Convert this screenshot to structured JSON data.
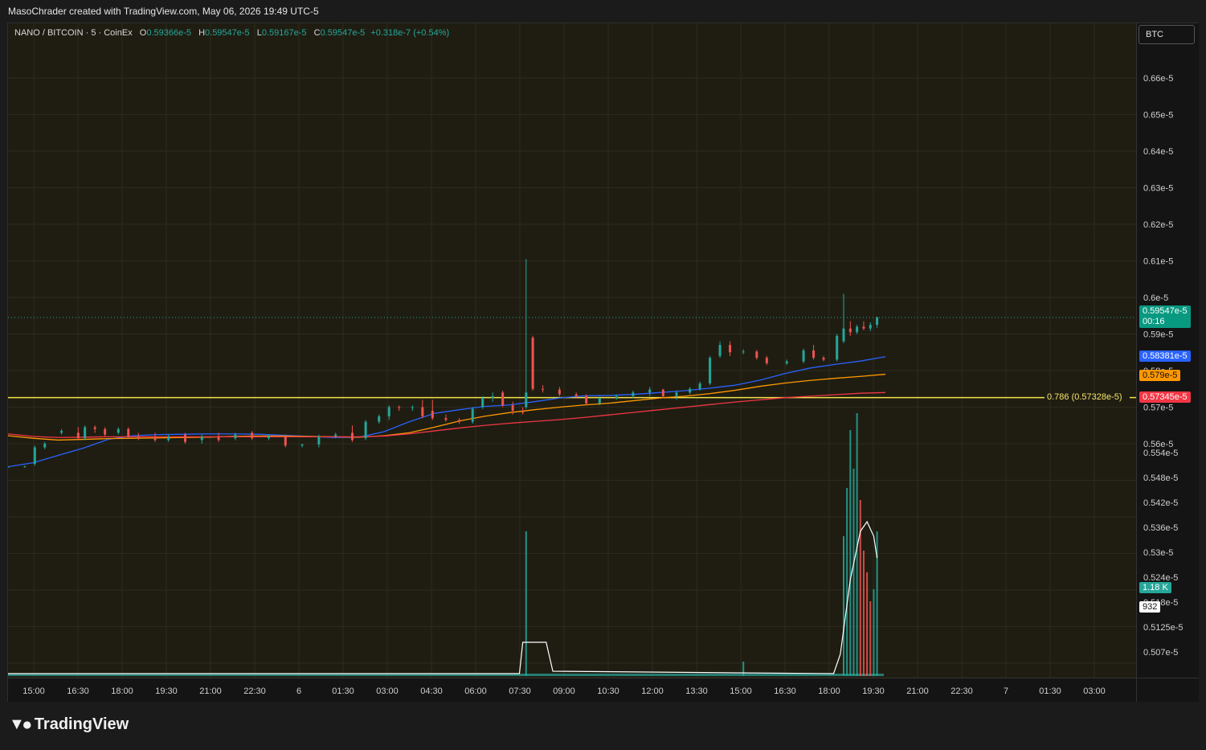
{
  "credit": "MasoChrader created with TradingView.com, May 06, 2026 19:49 UTC-5",
  "legend": {
    "symbol": "NANO / BITCOIN · 5 · CoinEx",
    "o_label": "O",
    "o": "0.59366e-5",
    "h_label": "H",
    "h": "0.59547e-5",
    "l_label": "L",
    "l": "0.59167e-5",
    "c_label": "C",
    "c": "0.59547e-5",
    "change": "+0.318e-7 (+0.54%)"
  },
  "currency": "BTC",
  "brand": "TradingView",
  "colors": {
    "bg": "#1f1d12",
    "up": "#26a69a",
    "down": "#ef5350",
    "ma_blue": "#2962ff",
    "ma_orange": "#ff9800",
    "ma_red": "#f23645",
    "fib": "#f5e34a",
    "volume_ma": "#ffffff"
  },
  "badges": {
    "last_price": "0.59547e-5",
    "countdown": "00:16",
    "ma_blue": "0.58381e-5",
    "ma_orange": "0.579e-5",
    "ma_red": "0.57345e-5",
    "volume": "1.18 K",
    "volume_ma": "932"
  },
  "fib_label": "0.786 (0.57328e-5)",
  "chart_data": {
    "type": "candlestick",
    "symbol": "NANO / BITCOIN",
    "interval": "5",
    "exchange": "CoinEx",
    "x_ticks": [
      "15:00",
      "16:30",
      "18:00",
      "19:30",
      "21:00",
      "22:30",
      "6",
      "01:30",
      "03:00",
      "04:30",
      "06:00",
      "07:30",
      "09:00",
      "10:30",
      "12:00",
      "13:30",
      "15:00",
      "16:30",
      "18:00",
      "19:30",
      "21:00",
      "22:30",
      "7",
      "01:30",
      "03:00"
    ],
    "y_ticks_price": [
      "0.66e-5",
      "0.65e-5",
      "0.64e-5",
      "0.63e-5",
      "0.62e-5",
      "0.61e-5",
      "0.6e-5",
      "0.59e-5",
      "0.58e-5",
      "0.57e-5",
      "0.56e-5"
    ],
    "y_ticks_volume": [
      "0.554e-5",
      "0.548e-5",
      "0.542e-5",
      "0.536e-5",
      "0.53e-5",
      "0.524e-5",
      "0.518e-5",
      "0.5125e-5",
      "0.507e-5"
    ],
    "fib_level": {
      "ratio": 0.786,
      "price": 0.57328
    },
    "moving_averages": [
      {
        "color": "blue",
        "last": 0.58381,
        "points": [
          [
            0,
            0.5537
          ],
          [
            2,
            0.5548
          ],
          [
            4,
            0.5568
          ],
          [
            6,
            0.5588
          ],
          [
            8,
            0.5612
          ],
          [
            10,
            0.5622
          ],
          [
            12,
            0.5625
          ],
          [
            14,
            0.5626
          ],
          [
            16,
            0.5627
          ],
          [
            18,
            0.5627
          ],
          [
            20,
            0.5626
          ],
          [
            22,
            0.5623
          ],
          [
            24,
            0.562
          ],
          [
            26,
            0.5617
          ],
          [
            28,
            0.5618
          ],
          [
            30,
            0.5633
          ],
          [
            32,
            0.566
          ],
          [
            34,
            0.5683
          ],
          [
            36,
            0.5693
          ],
          [
            38,
            0.5702
          ],
          [
            40,
            0.5706
          ],
          [
            42,
            0.5715
          ],
          [
            44,
            0.5725
          ],
          [
            46,
            0.5731
          ],
          [
            48,
            0.5732
          ],
          [
            50,
            0.5735
          ],
          [
            52,
            0.574
          ],
          [
            54,
            0.5745
          ],
          [
            56,
            0.5752
          ],
          [
            58,
            0.576
          ],
          [
            60,
            0.5774
          ],
          [
            62,
            0.5792
          ],
          [
            64,
            0.5807
          ],
          [
            66,
            0.5817
          ],
          [
            68,
            0.5826
          ],
          [
            70,
            0.5838
          ]
        ]
      },
      {
        "color": "orange",
        "last": 0.579,
        "points": [
          [
            0,
            0.5622
          ],
          [
            2,
            0.5615
          ],
          [
            4,
            0.561
          ],
          [
            6,
            0.5612
          ],
          [
            8,
            0.5614
          ],
          [
            10,
            0.5615
          ],
          [
            12,
            0.5616
          ],
          [
            14,
            0.5617
          ],
          [
            16,
            0.5618
          ],
          [
            18,
            0.562
          ],
          [
            20,
            0.5621
          ],
          [
            22,
            0.5621
          ],
          [
            24,
            0.562
          ],
          [
            26,
            0.5619
          ],
          [
            28,
            0.5618
          ],
          [
            30,
            0.5622
          ],
          [
            32,
            0.563
          ],
          [
            34,
            0.5645
          ],
          [
            36,
            0.5662
          ],
          [
            38,
            0.5675
          ],
          [
            40,
            0.5685
          ],
          [
            42,
            0.5693
          ],
          [
            44,
            0.57
          ],
          [
            46,
            0.5706
          ],
          [
            48,
            0.5711
          ],
          [
            50,
            0.5718
          ],
          [
            52,
            0.5725
          ],
          [
            54,
            0.573
          ],
          [
            56,
            0.5737
          ],
          [
            58,
            0.5746
          ],
          [
            60,
            0.5757
          ],
          [
            62,
            0.5766
          ],
          [
            64,
            0.5773
          ],
          [
            66,
            0.5779
          ],
          [
            68,
            0.5784
          ],
          [
            70,
            0.579
          ]
        ]
      },
      {
        "color": "red",
        "last": 0.57345,
        "points": [
          [
            0,
            0.5627
          ],
          [
            2,
            0.562
          ],
          [
            4,
            0.5617
          ],
          [
            6,
            0.5618
          ],
          [
            8,
            0.5619
          ],
          [
            10,
            0.5619
          ],
          [
            12,
            0.5619
          ],
          [
            14,
            0.5619
          ],
          [
            16,
            0.5619
          ],
          [
            18,
            0.5619
          ],
          [
            20,
            0.5619
          ],
          [
            22,
            0.5619
          ],
          [
            24,
            0.5619
          ],
          [
            26,
            0.5619
          ],
          [
            28,
            0.5619
          ],
          [
            30,
            0.5621
          ],
          [
            32,
            0.5627
          ],
          [
            34,
            0.5635
          ],
          [
            36,
            0.5643
          ],
          [
            38,
            0.565
          ],
          [
            40,
            0.5656
          ],
          [
            42,
            0.5661
          ],
          [
            44,
            0.5666
          ],
          [
            46,
            0.5672
          ],
          [
            48,
            0.5679
          ],
          [
            50,
            0.5686
          ],
          [
            52,
            0.5693
          ],
          [
            54,
            0.57
          ],
          [
            56,
            0.5707
          ],
          [
            58,
            0.5714
          ],
          [
            60,
            0.572
          ],
          [
            62,
            0.5726
          ],
          [
            64,
            0.573
          ],
          [
            66,
            0.5734
          ],
          [
            68,
            0.5738
          ],
          [
            70,
            0.574
          ]
        ]
      }
    ],
    "candles": [
      {
        "x": 0.0,
        "o": 0.5537,
        "h": 0.5537,
        "l": 0.5537,
        "c": 0.5537
      },
      {
        "x": 1.0,
        "o": 0.5537,
        "h": 0.554,
        "l": 0.5535,
        "c": 0.5538
      },
      {
        "x": 1.6,
        "o": 0.5545,
        "h": 0.5595,
        "l": 0.554,
        "c": 0.559
      },
      {
        "x": 2.2,
        "o": 0.559,
        "h": 0.5605,
        "l": 0.5585,
        "c": 0.56
      },
      {
        "x": 3.2,
        "o": 0.563,
        "h": 0.564,
        "l": 0.5625,
        "c": 0.5635
      },
      {
        "x": 4.2,
        "o": 0.563,
        "h": 0.5645,
        "l": 0.561,
        "c": 0.5615
      },
      {
        "x": 4.6,
        "o": 0.5615,
        "h": 0.565,
        "l": 0.561,
        "c": 0.5645
      },
      {
        "x": 5.2,
        "o": 0.5645,
        "h": 0.565,
        "l": 0.563,
        "c": 0.564
      },
      {
        "x": 5.8,
        "o": 0.564,
        "h": 0.5645,
        "l": 0.562,
        "c": 0.5625
      },
      {
        "x": 6.6,
        "o": 0.563,
        "h": 0.5645,
        "l": 0.5625,
        "c": 0.564
      },
      {
        "x": 7.2,
        "o": 0.564,
        "h": 0.5645,
        "l": 0.5615,
        "c": 0.562
      },
      {
        "x": 7.8,
        "o": 0.562,
        "h": 0.563,
        "l": 0.561,
        "c": 0.5615
      },
      {
        "x": 8.8,
        "o": 0.562,
        "h": 0.563,
        "l": 0.5605,
        "c": 0.561
      },
      {
        "x": 9.6,
        "o": 0.561,
        "h": 0.5625,
        "l": 0.5605,
        "c": 0.562
      },
      {
        "x": 10.6,
        "o": 0.5625,
        "h": 0.563,
        "l": 0.56,
        "c": 0.5605
      },
      {
        "x": 11.6,
        "o": 0.561,
        "h": 0.5625,
        "l": 0.56,
        "c": 0.562
      },
      {
        "x": 12.6,
        "o": 0.562,
        "h": 0.563,
        "l": 0.5605,
        "c": 0.561
      },
      {
        "x": 13.6,
        "o": 0.5615,
        "h": 0.563,
        "l": 0.561,
        "c": 0.5625
      },
      {
        "x": 14.6,
        "o": 0.563,
        "h": 0.5635,
        "l": 0.561,
        "c": 0.5615
      },
      {
        "x": 15.6,
        "o": 0.5615,
        "h": 0.5625,
        "l": 0.561,
        "c": 0.562
      },
      {
        "x": 16.6,
        "o": 0.562,
        "h": 0.5625,
        "l": 0.559,
        "c": 0.5595
      },
      {
        "x": 17.6,
        "o": 0.5595,
        "h": 0.56,
        "l": 0.559,
        "c": 0.5598
      },
      {
        "x": 18.6,
        "o": 0.5598,
        "h": 0.5625,
        "l": 0.559,
        "c": 0.562
      },
      {
        "x": 19.6,
        "o": 0.562,
        "h": 0.563,
        "l": 0.5615,
        "c": 0.5625
      },
      {
        "x": 20.6,
        "o": 0.563,
        "h": 0.565,
        "l": 0.5605,
        "c": 0.561
      },
      {
        "x": 21.4,
        "o": 0.5615,
        "h": 0.5665,
        "l": 0.561,
        "c": 0.566
      },
      {
        "x": 22.2,
        "o": 0.566,
        "h": 0.568,
        "l": 0.5655,
        "c": 0.5675
      },
      {
        "x": 22.8,
        "o": 0.5675,
        "h": 0.5705,
        "l": 0.5665,
        "c": 0.57
      },
      {
        "x": 23.4,
        "o": 0.57,
        "h": 0.5705,
        "l": 0.569,
        "c": 0.5698
      },
      {
        "x": 24.2,
        "o": 0.5698,
        "h": 0.5705,
        "l": 0.569,
        "c": 0.57
      },
      {
        "x": 24.8,
        "o": 0.57,
        "h": 0.572,
        "l": 0.567,
        "c": 0.5675
      },
      {
        "x": 25.4,
        "o": 0.569,
        "h": 0.572,
        "l": 0.5665,
        "c": 0.567
      },
      {
        "x": 26.2,
        "o": 0.567,
        "h": 0.568,
        "l": 0.566,
        "c": 0.5665
      },
      {
        "x": 27.0,
        "o": 0.5665,
        "h": 0.567,
        "l": 0.5655,
        "c": 0.566
      },
      {
        "x": 27.8,
        "o": 0.566,
        "h": 0.57,
        "l": 0.5655,
        "c": 0.5695
      },
      {
        "x": 28.4,
        "o": 0.57,
        "h": 0.573,
        "l": 0.5695,
        "c": 0.5725
      },
      {
        "x": 29.0,
        "o": 0.5725,
        "h": 0.574,
        "l": 0.5715,
        "c": 0.573
      },
      {
        "x": 29.6,
        "o": 0.574,
        "h": 0.5745,
        "l": 0.57,
        "c": 0.5705
      },
      {
        "x": 30.2,
        "o": 0.5705,
        "h": 0.5715,
        "l": 0.568,
        "c": 0.569
      },
      {
        "x": 30.8,
        "o": 0.569,
        "h": 0.57,
        "l": 0.568,
        "c": 0.5685
      },
      {
        "x": 31.0,
        "o": 0.57,
        "h": 0.6105,
        "l": 0.5695,
        "c": 0.574
      },
      {
        "x": 31.4,
        "o": 0.589,
        "h": 0.5895,
        "l": 0.5745,
        "c": 0.575
      },
      {
        "x": 32.0,
        "o": 0.575,
        "h": 0.576,
        "l": 0.574,
        "c": 0.5748
      },
      {
        "x": 33.0,
        "o": 0.5748,
        "h": 0.5755,
        "l": 0.573,
        "c": 0.5735
      },
      {
        "x": 34.0,
        "o": 0.5735,
        "h": 0.574,
        "l": 0.5725,
        "c": 0.573
      },
      {
        "x": 34.6,
        "o": 0.573,
        "h": 0.5735,
        "l": 0.5705,
        "c": 0.571
      },
      {
        "x": 35.4,
        "o": 0.571,
        "h": 0.573,
        "l": 0.5705,
        "c": 0.5725
      },
      {
        "x": 36.4,
        "o": 0.5725,
        "h": 0.5735,
        "l": 0.572,
        "c": 0.573
      },
      {
        "x": 37.4,
        "o": 0.573,
        "h": 0.5745,
        "l": 0.5725,
        "c": 0.574
      },
      {
        "x": 38.4,
        "o": 0.574,
        "h": 0.5755,
        "l": 0.573,
        "c": 0.5748
      },
      {
        "x": 39.2,
        "o": 0.5748,
        "h": 0.575,
        "l": 0.5725,
        "c": 0.573
      },
      {
        "x": 40.0,
        "o": 0.573,
        "h": 0.5745,
        "l": 0.572,
        "c": 0.574
      },
      {
        "x": 40.8,
        "o": 0.574,
        "h": 0.5755,
        "l": 0.5735,
        "c": 0.575
      },
      {
        "x": 41.4,
        "o": 0.575,
        "h": 0.577,
        "l": 0.5745,
        "c": 0.5765
      },
      {
        "x": 42.0,
        "o": 0.5765,
        "h": 0.584,
        "l": 0.576,
        "c": 0.5835
      },
      {
        "x": 42.6,
        "o": 0.584,
        "h": 0.588,
        "l": 0.5835,
        "c": 0.587
      },
      {
        "x": 43.2,
        "o": 0.587,
        "h": 0.588,
        "l": 0.584,
        "c": 0.585
      },
      {
        "x": 44.0,
        "o": 0.585,
        "h": 0.5858,
        "l": 0.5845,
        "c": 0.5852
      },
      {
        "x": 44.8,
        "o": 0.5852,
        "h": 0.5856,
        "l": 0.583,
        "c": 0.5835
      },
      {
        "x": 45.4,
        "o": 0.5835,
        "h": 0.584,
        "l": 0.5815,
        "c": 0.582
      },
      {
        "x": 46.6,
        "o": 0.582,
        "h": 0.583,
        "l": 0.5815,
        "c": 0.5825
      },
      {
        "x": 47.6,
        "o": 0.5825,
        "h": 0.586,
        "l": 0.582,
        "c": 0.5855
      },
      {
        "x": 48.2,
        "o": 0.5855,
        "h": 0.587,
        "l": 0.583,
        "c": 0.5835
      },
      {
        "x": 48.8,
        "o": 0.5835,
        "h": 0.584,
        "l": 0.5825,
        "c": 0.583
      },
      {
        "x": 49.6,
        "o": 0.583,
        "h": 0.59,
        "l": 0.5825,
        "c": 0.5895
      },
      {
        "x": 50.0,
        "o": 0.588,
        "h": 0.601,
        "l": 0.5875,
        "c": 0.5915
      },
      {
        "x": 50.4,
        "o": 0.5915,
        "h": 0.5935,
        "l": 0.5895,
        "c": 0.5905
      },
      {
        "x": 50.8,
        "o": 0.5905,
        "h": 0.5925,
        "l": 0.59,
        "c": 0.592
      },
      {
        "x": 51.2,
        "o": 0.592,
        "h": 0.5935,
        "l": 0.591,
        "c": 0.5915
      },
      {
        "x": 51.6,
        "o": 0.5915,
        "h": 0.5932,
        "l": 0.5908,
        "c": 0.5925
      },
      {
        "x": 52.0,
        "o": 0.5925,
        "h": 0.5948,
        "l": 0.5917,
        "c": 0.5945
      }
    ],
    "volume": [
      {
        "x": 31.0,
        "v": 6.0
      },
      {
        "x": 50.0,
        "v": 5.8
      },
      {
        "x": 50.2,
        "v": 7.8
      },
      {
        "x": 50.4,
        "v": 10.2
      },
      {
        "x": 50.6,
        "v": 8.6
      },
      {
        "x": 50.8,
        "v": 10.9
      },
      {
        "x": 51.0,
        "v": 7.3
      },
      {
        "x": 51.2,
        "v": 5.2
      },
      {
        "x": 51.4,
        "v": 4.3
      },
      {
        "x": 51.6,
        "v": 3.1
      },
      {
        "x": 51.8,
        "v": 3.6
      },
      {
        "x": 52.0,
        "v": 6.0
      },
      {
        "x": 44.0,
        "v": 0.6
      }
    ],
    "volume_ma": [
      [
        0,
        0.1
      ],
      [
        30.6,
        0.1
      ],
      [
        30.8,
        1.4
      ],
      [
        32.2,
        1.4
      ],
      [
        32.6,
        0.2
      ],
      [
        49.4,
        0.1
      ],
      [
        49.8,
        0.9
      ],
      [
        50.4,
        4.0
      ],
      [
        51.0,
        6.0
      ],
      [
        51.4,
        6.4
      ],
      [
        51.8,
        5.8
      ],
      [
        52.0,
        4.9
      ]
    ]
  }
}
